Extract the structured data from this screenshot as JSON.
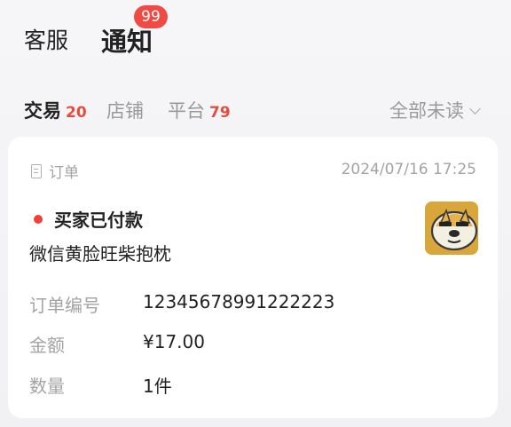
{
  "header": {
    "tabs": [
      {
        "label": "客服"
      },
      {
        "label": "通知"
      }
    ],
    "badge": "99"
  },
  "subtabs": [
    {
      "label": "交易",
      "count": "20"
    },
    {
      "label": "店铺",
      "count": ""
    },
    {
      "label": "平台",
      "count": "79"
    }
  ],
  "filter": {
    "label": "全部未读"
  },
  "card": {
    "type_label": "订单",
    "time": "2024/07/16 17:25",
    "status": "买家已付款",
    "product": "微信黄脸旺柴抱枕",
    "rows": [
      {
        "label": "订单编号",
        "value": "12345678991222223"
      },
      {
        "label": "金额",
        "value": "¥17.00"
      },
      {
        "label": "数量",
        "value": "1件"
      }
    ]
  },
  "colors": {
    "accent_red": "#ef4a43",
    "card_bg": "#ffffff",
    "page_bg": "#f4f4f6"
  }
}
